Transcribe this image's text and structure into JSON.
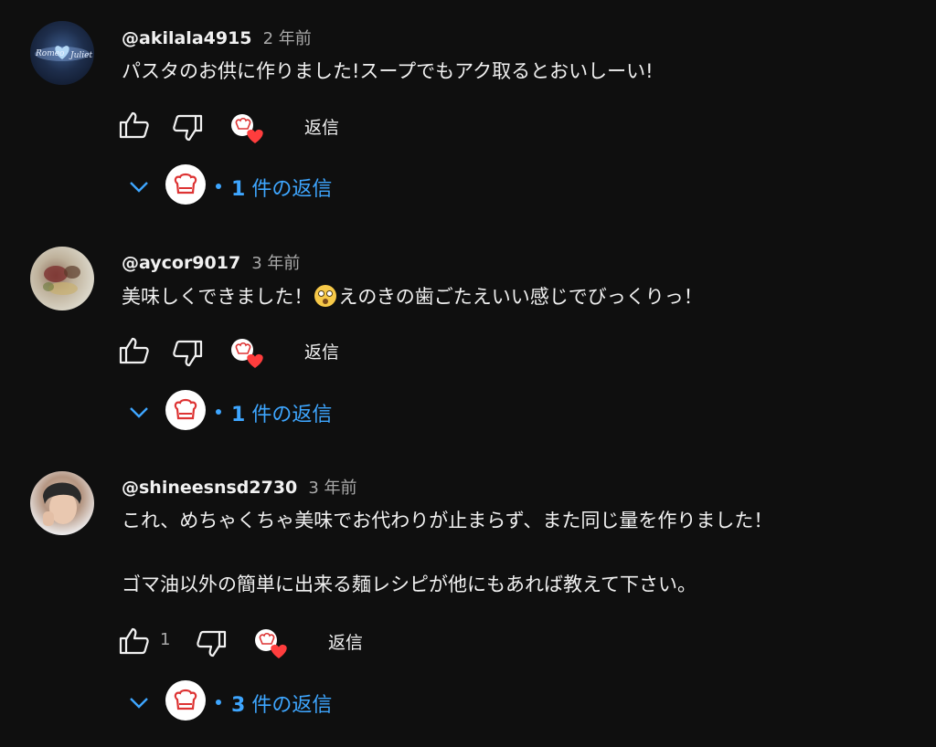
{
  "comments": [
    {
      "handle": "@akilala4915",
      "time": "2 年前",
      "text": "パスタのお供に作りました!スープでもアク取るとおいしーい!",
      "like_count": "",
      "reply_label": "返信",
      "replies_count": "1",
      "replies_suffix": "件の返信",
      "avatar_icon": "galaxy-avatar"
    },
    {
      "handle": "@aycor9017",
      "time": "3 年前",
      "text_before": "美味しくできました！",
      "emoji": "flushed-face-emoji",
      "text_after": "えのきの歯ごたえいい感じでびっくりっ！",
      "like_count": "",
      "reply_label": "返信",
      "replies_count": "1",
      "replies_suffix": "件の返信",
      "avatar_icon": "food-photo-avatar"
    },
    {
      "handle": "@shineesnsd2730",
      "time": "3 年前",
      "text_line1": "これ、めちゃくちゃ美味でお代わりが止まらず、また同じ量を作りました！",
      "text_line2": "ゴマ油以外の簡単に出来る麺レシピが他にもあれば教えて下さい。",
      "like_count": "1",
      "reply_label": "返信",
      "replies_count": "3",
      "replies_suffix": "件の返信",
      "avatar_icon": "person-photo-avatar"
    }
  ],
  "colors": {
    "background": "#0f0f0f",
    "link_blue": "#3ea6ff",
    "heart_red": "#ff3d3d"
  }
}
